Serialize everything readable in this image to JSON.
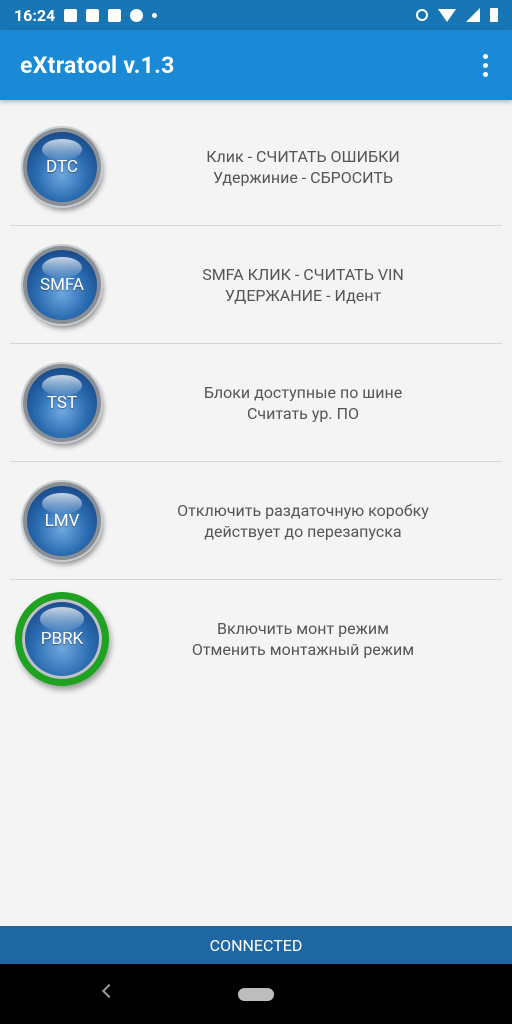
{
  "status_bar": {
    "time": "16:24",
    "icons": [
      "image-icon",
      "news-icon",
      "calendar-icon",
      "pinterest-icon",
      "dot-icon",
      "alarm-icon",
      "wifi-icon",
      "signal-icon",
      "battery-icon"
    ]
  },
  "app_bar": {
    "title": "eXtratool v.1.3",
    "menu_icon": "more-vert-icon"
  },
  "rows": [
    {
      "button": "DTC",
      "line1": "Клик -  СЧИТАТЬ ОШИБКИ",
      "line2": "Удержиние -  СБРОСИТЬ"
    },
    {
      "button": "SMFA",
      "line1": "SMFA КЛИК -  СЧИТАТЬ VIN",
      "line2": "УДЕРЖАНИЕ -  Идент"
    },
    {
      "button": "TST",
      "line1": "Блоки доступные по шине",
      "line2": "Считать ур. ПО"
    },
    {
      "button": "LMV",
      "line1": "Отключить раздаточную коробку",
      "line2": "действует до перезапуска"
    },
    {
      "button": "PBRK",
      "line1": "Включить монт режим",
      "line2": "Отменить монтажный режим"
    }
  ],
  "status": {
    "connection": "CONNECTED"
  },
  "colors": {
    "status_bar": "#1976b5",
    "app_bar": "#1a8ad6",
    "connected_bar": "#1f67a3",
    "active_ring": "#1fa21f"
  }
}
